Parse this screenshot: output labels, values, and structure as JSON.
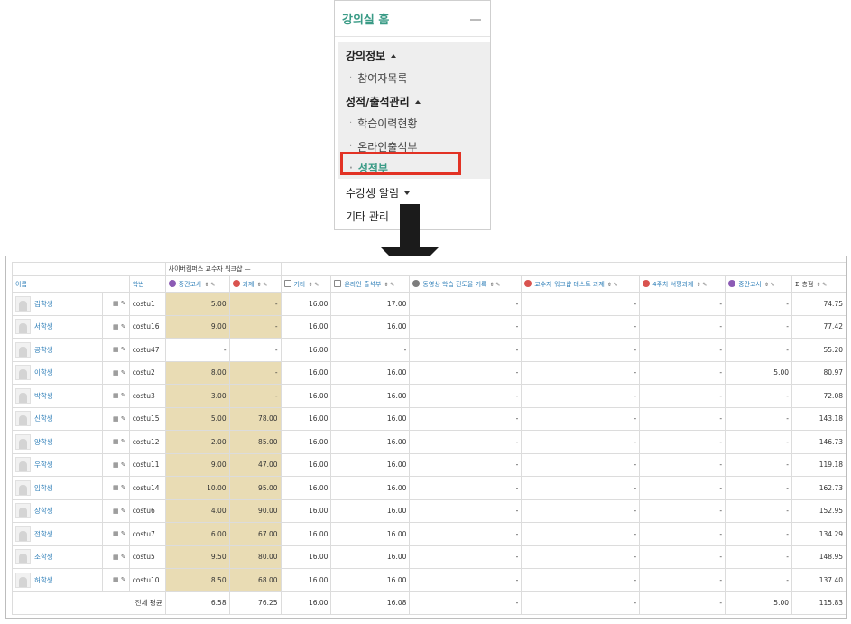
{
  "menu": {
    "title": "강의실 홈",
    "sections": [
      {
        "label": "강의정보",
        "items": [
          "참여자목록"
        ]
      },
      {
        "label": "성적/출석관리",
        "items": [
          "학습이력현황",
          "온라인출석부",
          "성적부"
        ]
      }
    ],
    "active_item": "성적부",
    "extra": [
      {
        "label": "수강생 알림"
      },
      {
        "label": "기타 관리"
      }
    ]
  },
  "grader": {
    "category_label": "사이버캠퍼스 교수자 워크샵 —",
    "headers": {
      "name": "이름",
      "id": "학번",
      "items": [
        {
          "label": "중간고사",
          "icon": "quiz-icon"
        },
        {
          "label": "과제",
          "icon": "assignment-icon"
        },
        {
          "label": "기타",
          "icon": "manual-item-icon"
        },
        {
          "label": "온라인 출석부",
          "icon": "manual-item-icon"
        },
        {
          "label": "동영상 학습 진도율 기록",
          "icon": "progress-icon"
        },
        {
          "label": "교수자 워크샵 테스트 과제",
          "icon": "assignment-icon"
        },
        {
          "label": "4주차 서평과제",
          "icon": "assignment-icon"
        },
        {
          "label": "중간고사",
          "icon": "quiz-icon"
        },
        {
          "label": "총점",
          "icon": "sigma-icon"
        }
      ]
    },
    "rows": [
      {
        "name": "김학생",
        "id": "costu1",
        "vals": [
          "5.00",
          "-",
          "16.00",
          "17.00",
          "-",
          "-",
          "-",
          "-",
          "74.75"
        ]
      },
      {
        "name": "서학생",
        "id": "costu16",
        "vals": [
          "9.00",
          "-",
          "16.00",
          "16.00",
          "-",
          "-",
          "-",
          "-",
          "77.42"
        ]
      },
      {
        "name": "공학생",
        "id": "costu47",
        "vals": [
          "-",
          "-",
          "16.00",
          "-",
          "-",
          "-",
          "-",
          "-",
          "55.20"
        ]
      },
      {
        "name": "이학생",
        "id": "costu2",
        "vals": [
          "8.00",
          "-",
          "16.00",
          "16.00",
          "-",
          "-",
          "-",
          "5.00",
          "80.97"
        ]
      },
      {
        "name": "박학생",
        "id": "costu3",
        "vals": [
          "3.00",
          "-",
          "16.00",
          "16.00",
          "-",
          "-",
          "-",
          "-",
          "72.08"
        ]
      },
      {
        "name": "신학생",
        "id": "costu15",
        "vals": [
          "5.00",
          "78.00",
          "16.00",
          "16.00",
          "-",
          "-",
          "-",
          "-",
          "143.18"
        ]
      },
      {
        "name": "양학생",
        "id": "costu12",
        "vals": [
          "2.00",
          "85.00",
          "16.00",
          "16.00",
          "-",
          "-",
          "-",
          "-",
          "146.73"
        ]
      },
      {
        "name": "우학생",
        "id": "costu11",
        "vals": [
          "9.00",
          "47.00",
          "16.00",
          "16.00",
          "-",
          "-",
          "-",
          "-",
          "119.18"
        ]
      },
      {
        "name": "임학생",
        "id": "costu14",
        "vals": [
          "10.00",
          "95.00",
          "16.00",
          "16.00",
          "-",
          "-",
          "-",
          "-",
          "162.73"
        ]
      },
      {
        "name": "장학생",
        "id": "costu6",
        "vals": [
          "4.00",
          "90.00",
          "16.00",
          "16.00",
          "-",
          "-",
          "-",
          "-",
          "152.95"
        ]
      },
      {
        "name": "전학생",
        "id": "costu7",
        "vals": [
          "6.00",
          "67.00",
          "16.00",
          "16.00",
          "-",
          "-",
          "-",
          "-",
          "134.29"
        ]
      },
      {
        "name": "조학생",
        "id": "costu5",
        "vals": [
          "9.50",
          "80.00",
          "16.00",
          "16.00",
          "-",
          "-",
          "-",
          "-",
          "148.95"
        ]
      },
      {
        "name": "허학생",
        "id": "costu10",
        "vals": [
          "8.50",
          "68.00",
          "16.00",
          "16.00",
          "-",
          "-",
          "-",
          "-",
          "137.40"
        ]
      }
    ],
    "average": {
      "label": "전체 평균",
      "vals": [
        "6.58",
        "76.25",
        "16.00",
        "16.08",
        "-",
        "-",
        "-",
        "5.00",
        "115.83"
      ]
    },
    "highlight_color": "#e9dcb4"
  },
  "colors": {
    "accent": "#3a9b86",
    "highlight_box": "#e23224",
    "link": "#2f7fb8"
  }
}
